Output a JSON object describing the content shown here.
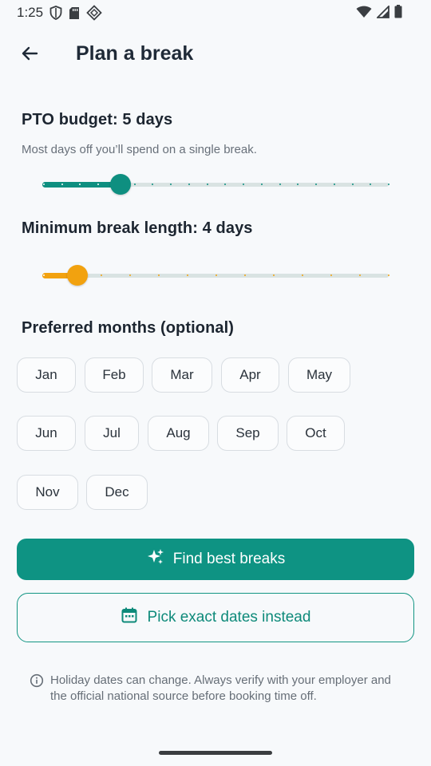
{
  "status_bar": {
    "time": "1:25"
  },
  "header": {
    "title": "Plan a break"
  },
  "pto": {
    "label": "PTO budget: 5 days",
    "helper": "Most days off you’ll spend on a single break.",
    "value": 5,
    "min": 1,
    "max": 20,
    "color": "#0e8f80"
  },
  "min_break": {
    "label": "Minimum break length: 4 days",
    "value": 4,
    "min": 3,
    "max": 15,
    "color": "#f2a20f"
  },
  "months": {
    "label": "Preferred months (optional)",
    "items": [
      "Jan",
      "Feb",
      "Mar",
      "Apr",
      "May",
      "Jun",
      "Jul",
      "Aug",
      "Sep",
      "Oct",
      "Nov",
      "Dec"
    ]
  },
  "actions": {
    "find_label": "Find best breaks",
    "pick_label": "Pick exact dates instead"
  },
  "disclaimer": "Holiday dates can change. Always verify with your employer and the official national source before booking time off.",
  "colors": {
    "accent": "#0e9383",
    "secondary_accent": "#f2a20f",
    "background": "#f7f9fb"
  }
}
